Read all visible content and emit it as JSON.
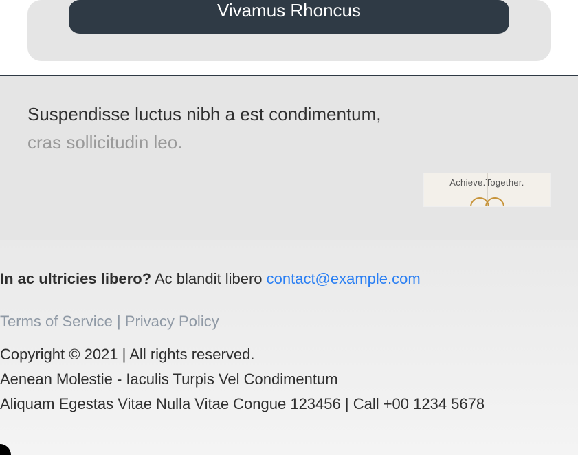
{
  "cta": {
    "label": "Vivamus Rhoncus"
  },
  "mid": {
    "line1": "Suspendisse luctus nibh a est condimentum,",
    "line2": "cras sollicitudin leo.",
    "promo_text": "Achieve.Together."
  },
  "footer": {
    "question_label": "In ac ultricies libero?",
    "question_text": " Ac blandit libero ",
    "email": "contact@example.com",
    "tos_label": "Terms of Service",
    "privacy_label": "Privacy Policy",
    "sep": " | ",
    "copyright": "Copyright © 2021 | All rights reserved.",
    "company": "Aenean Molestie - Iaculis Turpis Vel Condimentum",
    "address": "Aliquam Egestas Vitae Nulla Vitae Congue 123456 | Call +00 1234 5678"
  }
}
